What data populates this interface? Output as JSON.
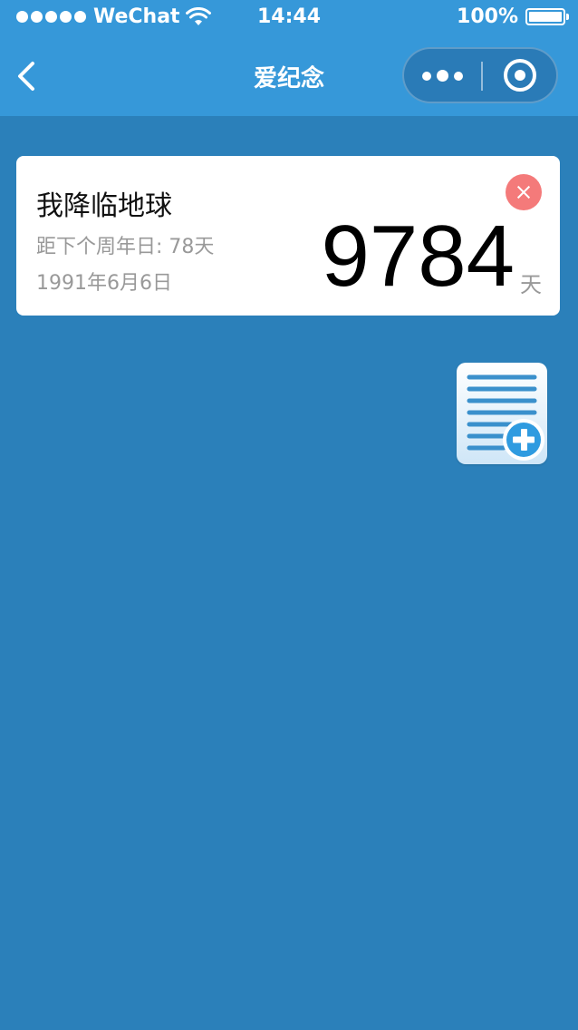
{
  "status_bar": {
    "carrier": "WeChat",
    "time": "14:44",
    "battery": "100%"
  },
  "nav": {
    "title": "爱纪念",
    "back_icon": "chevron-left-icon",
    "more_icon": "more-dots-icon",
    "close_icon": "target-circle-icon"
  },
  "card": {
    "title": "我降临地球",
    "countdown": "距下个周年日: 78天",
    "date": "1991年6月6日",
    "days": "9784",
    "days_unit": "天",
    "delete_icon": "close-icon"
  },
  "add_button": {
    "icon": "add-document-icon"
  },
  "colors": {
    "background": "#2b80ba",
    "topbar": "#3698d9",
    "delete": "#f47a7a",
    "card": "#ffffff"
  }
}
